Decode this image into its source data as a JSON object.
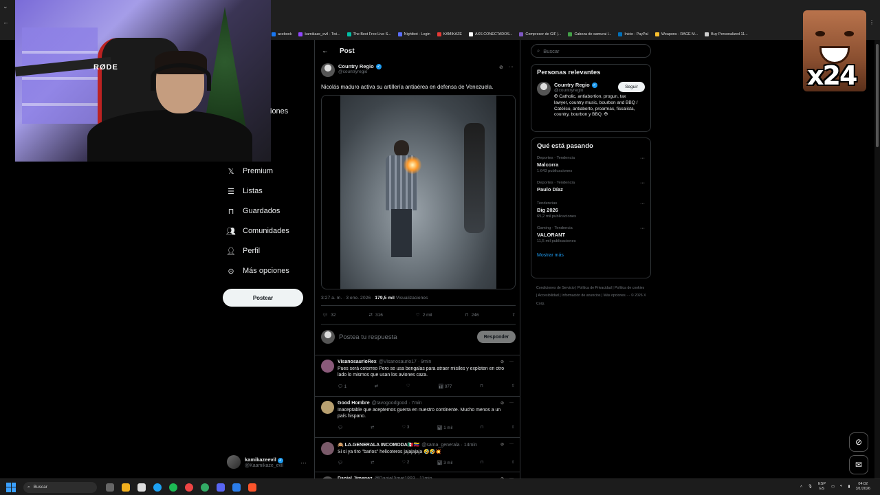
{
  "bookmarks": [
    {
      "label": "acebook",
      "color": "#1877f2"
    },
    {
      "label": "kamikaze_evil - Twi...",
      "color": "#9146ff"
    },
    {
      "label": "The Best Free Live S...",
      "color": "#00bfa5"
    },
    {
      "label": "Nightbot - Login",
      "color": "#5a6eff"
    },
    {
      "label": "KAMIKAZE",
      "color": "#e53935"
    },
    {
      "label": "AXS CONECTADOS...",
      "color": "#fff"
    },
    {
      "label": "Compresor de GIF |...",
      "color": "#7e57c2"
    },
    {
      "label": "Cabeza de samurai l...",
      "color": "#43a047"
    },
    {
      "label": "Inicio - PayPal",
      "color": "#0070ba"
    },
    {
      "label": "Weapons - RAGE M...",
      "color": "#fbc02d"
    },
    {
      "label": "Buy Personalized 11...",
      "color": "#ccc"
    }
  ],
  "webcam": {
    "mic_brand": "RØDE"
  },
  "emote": {
    "count": "x24"
  },
  "nav": {
    "partial_label": "iones",
    "items": [
      {
        "label": "Premium",
        "icon": "x-logo-icon"
      },
      {
        "label": "Listas",
        "icon": "list-icon"
      },
      {
        "label": "Guardados",
        "icon": "bookmark-icon"
      },
      {
        "label": "Comunidades",
        "icon": "communities-icon"
      },
      {
        "label": "Perfil",
        "icon": "profile-icon"
      },
      {
        "label": "Más opciones",
        "icon": "more-circle-icon"
      }
    ],
    "post_button": "Postear",
    "account": {
      "name": "kamikazeevil",
      "handle": "@Kaamikaze_evil",
      "more": "···"
    }
  },
  "post": {
    "header": "Post",
    "author": {
      "name": "Country Regio",
      "handle": "@countryregio"
    },
    "text": "Nicolás maduro activa su artillería antiaérea en defensa de Venezuela.",
    "meta": {
      "time": "3:27 a. m. · 3 ene. 2026 · ",
      "views": "179,5 mil",
      "views_label": " Visualizaciones"
    },
    "actions": {
      "replies": "32",
      "reposts": "316",
      "likes": "2 mil",
      "bookmarks": "246"
    },
    "reply_placeholder": "Postea tu respuesta",
    "reply_button": "Responder"
  },
  "comments": [
    {
      "name": "VisanosaurioRex",
      "handle": "@Visanosaurio17 · 9min",
      "text": "Pues será cotorreo Pero se usa bengalas para atraer misiles y exploten en otro lado lo mismos que usan los aviones caza.",
      "replies": "1",
      "reposts": "",
      "likes": "",
      "views": "977",
      "avatar": "#8a5a7a"
    },
    {
      "name": "Good Hombre",
      "handle": "@tavogoodgood · 7min",
      "text": "Inaceptable que aceptemos guerra en nuestro continente. Mucho menos a un país hispano.",
      "replies": "",
      "reposts": "",
      "likes": "3",
      "views": "1 mil",
      "avatar": "#b8a070"
    },
    {
      "name": "🙉 LA.GENERALA INCOMODA🇲🇽🇻🇪",
      "handle": "@sama_generala · 14min",
      "text": "Si si ya tiro \"barios\" helicoteros jajajajaja 🤣🤣💥",
      "replies": "",
      "reposts": "",
      "likes": "2",
      "views": "3 mil",
      "avatar": "#7a5a6a"
    },
    {
      "name": "Daniel Jimenez",
      "handle": "@DanielJimet1893 · 11min",
      "text": "",
      "replies": "",
      "reposts": "",
      "likes": "",
      "views": "",
      "avatar": "#555"
    }
  ],
  "sidebar": {
    "search_placeholder": "Buscar",
    "relevant_title": "Personas relevantes",
    "relevant_user": {
      "name": "Country Regio",
      "handle": "@countryregio",
      "bio": "✠ Catholic, antiabortion, progun, tax lawyer, country music, bourbon and BBQ / Católico, antiaborto, proarmas, fiscalista, country, bourbon y BBQ. ✠",
      "follow": "Seguir"
    },
    "trends_title": "Qué está pasando",
    "trends": [
      {
        "category": "Deportes · Tendencia",
        "title": "Malcorra",
        "count": "1.643 publicaciones"
      },
      {
        "category": "Deportes · Tendencia",
        "title": "Paulo Díaz",
        "count": ""
      },
      {
        "category": "Tendencias",
        "title": "Big 2026",
        "count": "65,2 mil publicaciones"
      },
      {
        "category": "Gaming · Tendencia",
        "title": "VALORANT",
        "count": "11,5 mil publicaciones"
      }
    ],
    "show_more": "Mostrar más",
    "footer": "Condiciones de Servicio | Política de Privacidad | Política de cookies | Accesibilidad | Información de anuncios | Más opciones ··· © 2026 X Corp."
  },
  "taskbar": {
    "search": "Buscar",
    "lang": "ESP",
    "lang2": "ES",
    "time": "04:02",
    "date": "3/1/2026"
  }
}
